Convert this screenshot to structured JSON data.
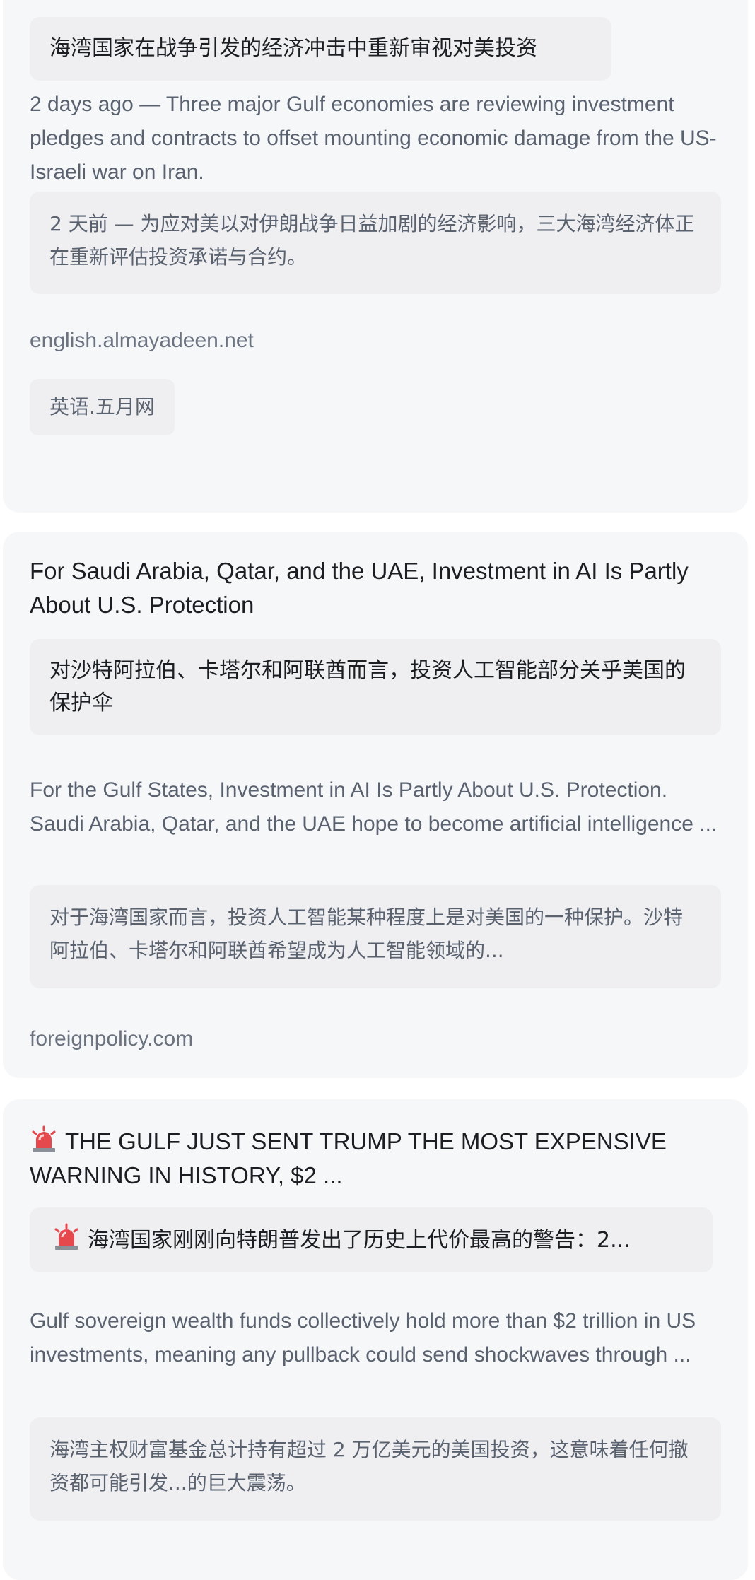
{
  "results": [
    {
      "title_zh": "海湾国家在战争引发的经济冲击中重新审视对美投资",
      "snippet_en": "2 days ago — Three major Gulf economies are reviewing investment pledges and contracts to offset mounting economic damage from the US-Israeli war on Iran.",
      "snippet_zh": "2 天前 — 为应对美以对伊朗战争日益加剧的经济影响，三大海湾经济体正在重新评估投资承诺与合约。",
      "source": "english.almayadeen.net",
      "source_zh": "英语.五月网"
    },
    {
      "title_en": "For Saudi Arabia, Qatar, and the UAE, Investment in AI Is Partly About U.S. Protection",
      "title_zh": "对沙特阿拉伯、卡塔尔和阿联酋而言，投资人工智能部分关乎美国的保护伞",
      "snippet_en": "For the Gulf States, Investment in AI Is Partly About U.S. Protection. Saudi Arabia, Qatar, and the UAE hope to become artificial intelligence ...",
      "snippet_zh": "对于海湾国家而言，投资人工智能某种程度上是对美国的一种保护。沙特阿拉伯、卡塔尔和阿联酋希望成为人工智能领域的...",
      "source": "foreignpolicy.com"
    },
    {
      "title_icon": "siren-icon",
      "title_en": "THE GULF JUST SENT TRUMP THE MOST EXPENSIVE WARNING IN HISTORY, $2 ...",
      "title_zh": "海湾国家刚刚向特朗普发出了历史上代价最高的警告：2...",
      "snippet_en": "Gulf sovereign wealth funds collectively hold more than $2 trillion in US investments, meaning any pullback could send shockwaves through ...",
      "snippet_zh": "海湾主权财富基金总计持有超过 2 万亿美元的美国投资，这意味着任何撤资都可能引发...的巨大震荡。"
    }
  ],
  "colors": {
    "card_bg": "#f6f7f9",
    "box_bg": "#efeff1",
    "title": "#1b1e22",
    "snippet": "#5a6270",
    "source": "#6b7380",
    "siren_red": "#e5484d"
  }
}
